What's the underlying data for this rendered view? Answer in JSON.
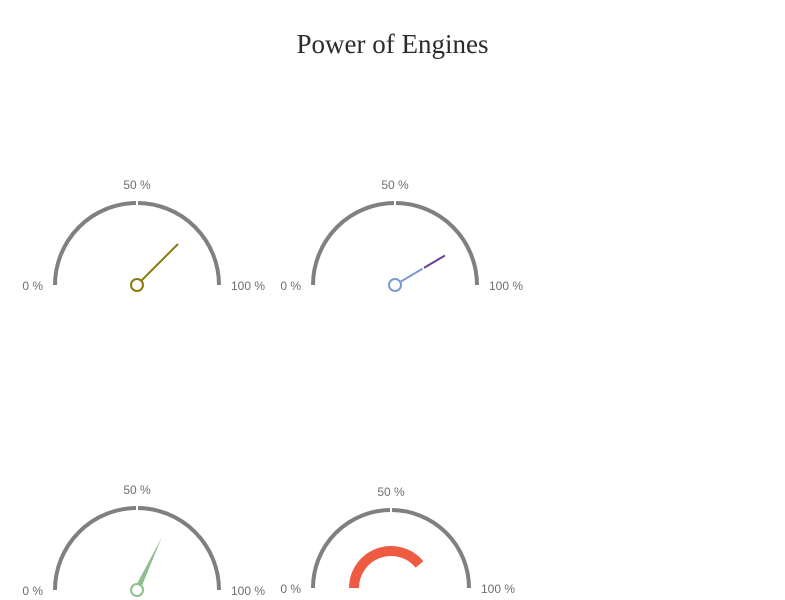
{
  "chart_data": {
    "type": "gauge",
    "title": "Power of Engines",
    "gauges": [
      {
        "min_label": "0 %",
        "mid_label": "50 %",
        "max_label": "100 %",
        "value": 75,
        "style": "needle",
        "colors": [
          "#8b7b0e"
        ]
      },
      {
        "min_label": "0 %",
        "mid_label": "50 %",
        "max_label": "100 %",
        "value": 83,
        "style": "needle-gradient",
        "colors": [
          "#7a9bd1",
          "#6a3f96"
        ]
      },
      {
        "min_label": "0 %",
        "mid_label": "50 %",
        "max_label": "100 %",
        "value": 64,
        "style": "needle-wedge",
        "colors": [
          "#8fbf8f"
        ]
      },
      {
        "min_label": "0 %",
        "mid_label": "50 %",
        "max_label": "100 %",
        "value": 78,
        "style": "progress-band",
        "colors": [
          "#ef5a42"
        ]
      }
    ],
    "track_color": "#808080"
  }
}
